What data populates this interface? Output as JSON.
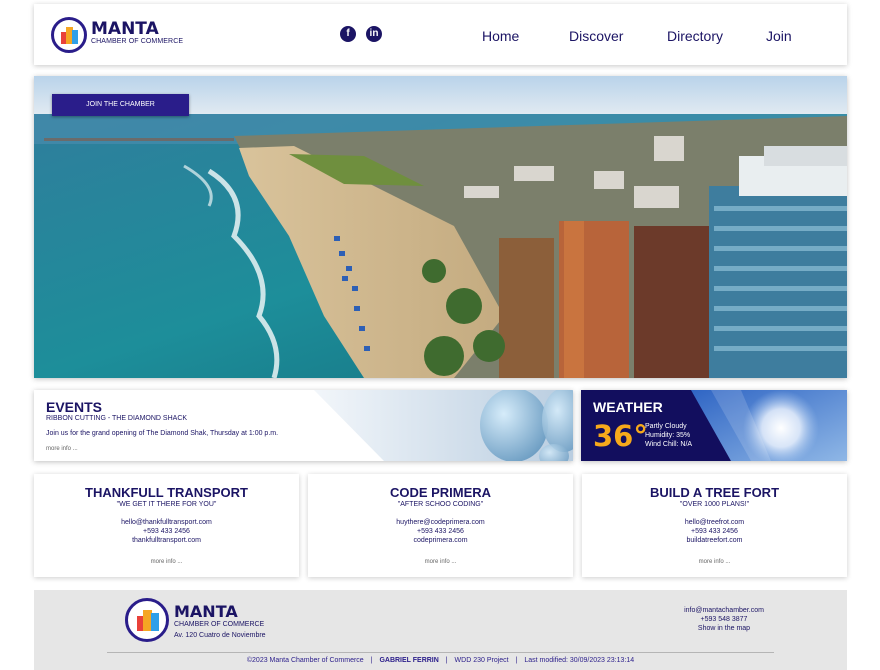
{
  "header": {
    "brand_name": "MANTA",
    "brand_sub": "CHAMBER OF COMMERCE",
    "social": [
      {
        "icon": "facebook-icon",
        "glyph": "f"
      },
      {
        "icon": "linkedin-icon",
        "glyph": "in"
      }
    ],
    "nav": [
      "Home",
      "Discover",
      "Directory",
      "Join"
    ]
  },
  "hero": {
    "cta_label": "JOIN THE CHAMBER"
  },
  "events": {
    "title": "EVENTS",
    "subtitle": "RIBBON CUTTING - THE DIAMOND SHACK",
    "text": "Join us for the grand opening of The Diamond Shak, Thursday at 1:00 p.m.",
    "more": "more info ..."
  },
  "weather": {
    "title": "WEATHER",
    "temp": "36°",
    "condition": "Partly Cloudy",
    "humidity": "Humidity: 35%",
    "wind": "Wind Chill: N/A"
  },
  "cards": [
    {
      "name": "THANKFULL TRANSPORT",
      "tagline": "\"WE GET IT THERE FOR YOU\"",
      "email": "hello@thankfulltransport.com",
      "phone": "+593 433 2456",
      "site": "thankfulltransport.com",
      "more": "more info ..."
    },
    {
      "name": "CODE PRIMERA",
      "tagline": "\"AFTER SCHOO CODING\"",
      "email": "huythere@codeprimera.com",
      "phone": "+593 433 2456",
      "site": "codeprimera.com",
      "more": "more info ..."
    },
    {
      "name": "BUILD A TREE FORT",
      "tagline": "\"OVER 1000 PLANS!\"",
      "email": "hello@treefrot.com",
      "phone": "+593 433 2456",
      "site": "buildatreefort.com",
      "more": "more info ..."
    }
  ],
  "footer": {
    "brand_name": "MANTA",
    "brand_sub": "CHAMBER OF COMMERCE",
    "address": "Av. 120 Cuatro de Noviembre",
    "email": "info@mantachamber.com",
    "phone": "+593 548 3877",
    "map_link": "Show in the map",
    "copyright": "©2023 Manta Chamber of Commerce",
    "author": "GABRIEL FERRIN",
    "project": "WDD 230 Project",
    "modified": "Last modified: 30/09/2023 23:13:14"
  },
  "colors": {
    "brand": "#1b1464",
    "accent": "#2a1d8a",
    "temperature": "#f6a91b"
  }
}
